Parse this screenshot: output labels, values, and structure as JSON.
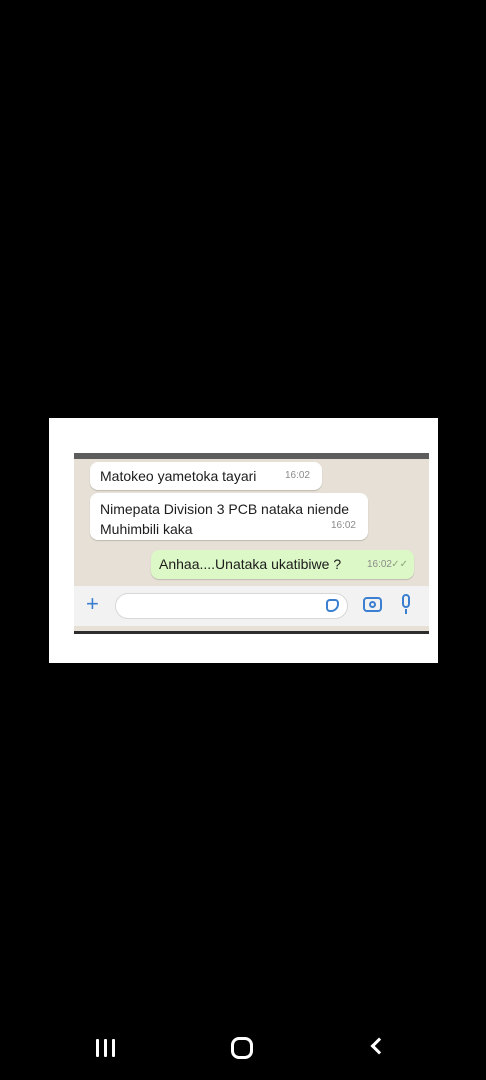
{
  "chat": {
    "messages": [
      {
        "direction": "incoming",
        "text_lines": [
          "Matokeo yametoka tayari"
        ],
        "time": "16:02"
      },
      {
        "direction": "incoming",
        "text_lines": [
          "Nimepata Division 3 PCB nataka niende",
          "Muhimbili kaka"
        ],
        "time": "16:02"
      },
      {
        "direction": "outgoing",
        "text_lines": [
          "Anhaa....Unataka ukatibiwe ?"
        ],
        "time": "16:02",
        "status_icon": "double-check-icon"
      }
    ],
    "input_bar": {
      "icons": [
        "plus-icon",
        "sticker-icon",
        "camera-icon",
        "mic-icon"
      ]
    }
  },
  "navigation_bar": {
    "icons": [
      "recent-apps-icon",
      "home-icon",
      "back-icon"
    ]
  },
  "colors": {
    "background": "#000000",
    "chat_background": "#e6e0d6",
    "incoming_bubble": "#ffffff",
    "outgoing_bubble": "#dcf8c6",
    "accent": "#3a7fd0"
  }
}
